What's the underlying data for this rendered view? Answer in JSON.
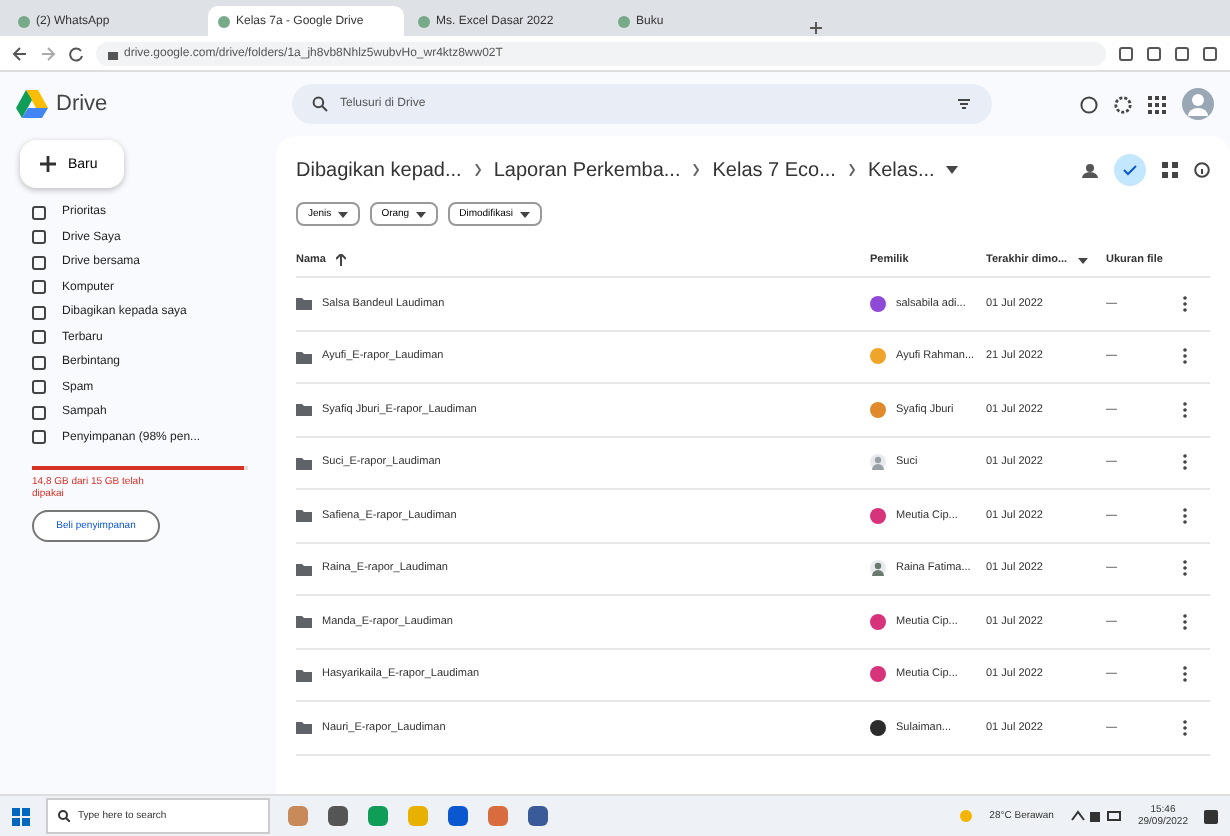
{
  "browser": {
    "tabs": [
      {
        "title": "(2) WhatsApp",
        "selected": false
      },
      {
        "title": "Kelas 7a - Google Drive",
        "selected": true
      },
      {
        "title": "Ms. Excel Dasar 2022",
        "selected": false
      },
      {
        "title": "Buku",
        "selected": false
      }
    ],
    "url": "drive.google.com/drive/folders/1a_jh8vb8Nhlz5wubvHo_wr4ktz8ww02T"
  },
  "app": {
    "name": "Drive",
    "search": {
      "placeholder": "Telusuri di Drive"
    }
  },
  "sidebar": {
    "new_button": "Baru",
    "items": [
      {
        "label": "Prioritas",
        "selected": false
      },
      {
        "label": "Drive Saya",
        "selected": false
      },
      {
        "label": "Drive bersama",
        "selected": false
      },
      {
        "label": "Komputer",
        "selected": false
      },
      {
        "label": "Dibagikan kepada saya",
        "selected": false
      },
      {
        "label": "Terbaru",
        "selected": false
      },
      {
        "label": "Berbintang",
        "selected": false
      },
      {
        "label": "Spam",
        "selected": false
      },
      {
        "label": "Sampah",
        "selected": false
      },
      {
        "label": "Penyimpanan (98% pen...",
        "selected": false
      }
    ],
    "storage": {
      "level": 0.98,
      "text": "14,8 GB dari 15 GB telah dipakai"
    },
    "storage_button": "Beli penyimpanan"
  },
  "breadcrumb": [
    "Dibagikan kepad...",
    "Laporan Perkemba...",
    "Kelas 7 Eco...",
    "Kelas..."
  ],
  "filters": [
    "Jenis",
    "Orang",
    "Dimodifikasi"
  ],
  "table": {
    "columns": [
      "Nama",
      "Pemilik",
      "Terakhir dimo...",
      "Ukuran file"
    ],
    "rows": [
      {
        "name": "Salsa Bandeul Laudiman",
        "owner": "salsabila adi...",
        "kind": "letter",
        "color": "#8e4ad6",
        "modified": "01 Jul 2022",
        "size": "—"
      },
      {
        "name": "Ayufi_E-rapor_Laudiman",
        "owner": "Ayufi Rahman...",
        "kind": "letter",
        "color": "#f0a52a",
        "modified": "21 Jul 2022",
        "size": "—"
      },
      {
        "name": "Syafiq Jburi_E-rapor_Laudiman",
        "owner": "Syafiq Jburi",
        "kind": "letter",
        "color": "#e08a2c",
        "modified": "01 Jul 2022",
        "size": "—"
      },
      {
        "name": "Suci_E-rapor_Laudiman",
        "owner": "Suci",
        "kind": "photo",
        "color": "#9aa0a6",
        "modified": "01 Jul 2022",
        "size": "—"
      },
      {
        "name": "Safiena_E-rapor_Laudiman",
        "owner": "Meutia Cip...",
        "kind": "letter",
        "color": "#d6337a",
        "modified": "01 Jul 2022",
        "size": "—"
      },
      {
        "name": "Raina_E-rapor_Laudiman",
        "owner": "Raina Fatima...",
        "kind": "photo",
        "color": "#6b7a6e",
        "modified": "01 Jul 2022",
        "size": "—"
      },
      {
        "name": "Manda_E-rapor_Laudiman",
        "owner": "Meutia Cip...",
        "kind": "letter",
        "color": "#d6337a",
        "modified": "01 Jul 2022",
        "size": "—"
      },
      {
        "name": "Hasyarikaila_E-rapor_Laudiman",
        "owner": "Meutia Cip...",
        "kind": "letter",
        "color": "#d6337a",
        "modified": "01 Jul 2022",
        "size": "—"
      },
      {
        "name": "Nauri_E-rapor_Laudiman",
        "owner": "Sulaiman...",
        "kind": "letter",
        "color": "#2b2b2b",
        "modified": "01 Jul 2022",
        "size": "—"
      }
    ]
  },
  "taskbar": {
    "search_placeholder": "Type here to search",
    "weather": "28°C Berawan",
    "time": "15:46",
    "date": "29/09/2022"
  }
}
